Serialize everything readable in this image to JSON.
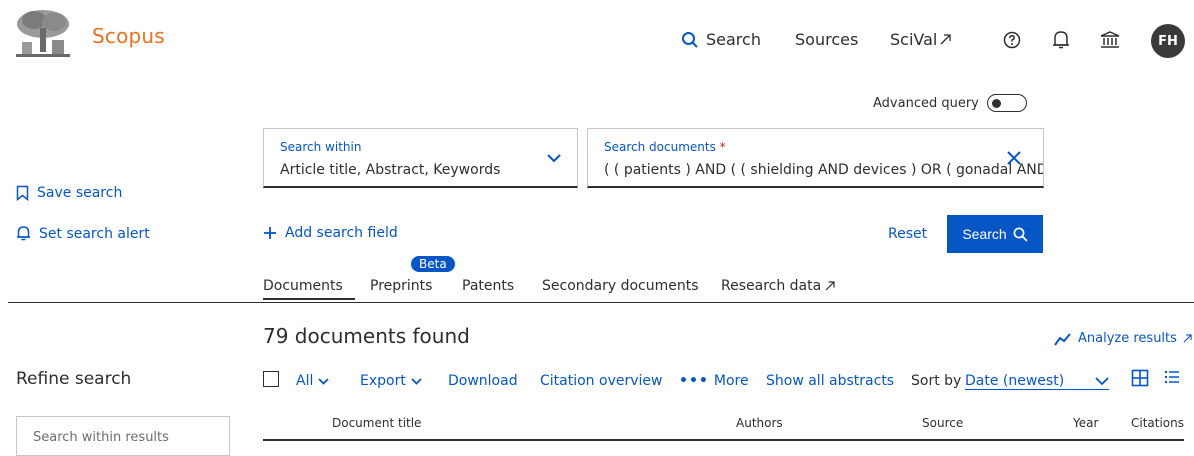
{
  "header": {
    "brand": "Scopus",
    "nav": {
      "search": "Search",
      "sources": "Sources",
      "scival": "SciVal"
    },
    "avatar_initials": "FH"
  },
  "query": {
    "advanced_label": "Advanced query",
    "within_label": "Search within",
    "within_value": "Article title, Abstract, Keywords",
    "docs_label": "Search documents",
    "docs_required_mark": "*",
    "docs_value": "( ( patients ) AND ( ( shielding AND devices ) OR ( gonadal AND shie",
    "add_field": "Add search field",
    "reset": "Reset",
    "search_button": "Search"
  },
  "sidebar": {
    "save_search": "Save search",
    "set_alert": "Set search alert",
    "refine_title": "Refine search",
    "search_within_placeholder": "Search within results"
  },
  "tabs": {
    "documents": "Documents",
    "preprints": "Preprints",
    "preprints_badge": "Beta",
    "patents": "Patents",
    "secondary": "Secondary documents",
    "research_data": "Research data"
  },
  "results": {
    "count_text": "79 documents found",
    "analyze": "Analyze results"
  },
  "toolbar": {
    "all": "All",
    "export": "Export",
    "download": "Download",
    "citation_overview": "Citation overview",
    "more": "More",
    "show_abstracts": "Show all abstracts",
    "sort_by": "Sort by",
    "sort_value": "Date (newest)"
  },
  "table": {
    "columns": [
      "Document title",
      "Authors",
      "Source",
      "Year",
      "Citations"
    ]
  },
  "colors": {
    "accent": "#0656c6",
    "brand": "#e9711c",
    "text": "#2e2e2e"
  }
}
